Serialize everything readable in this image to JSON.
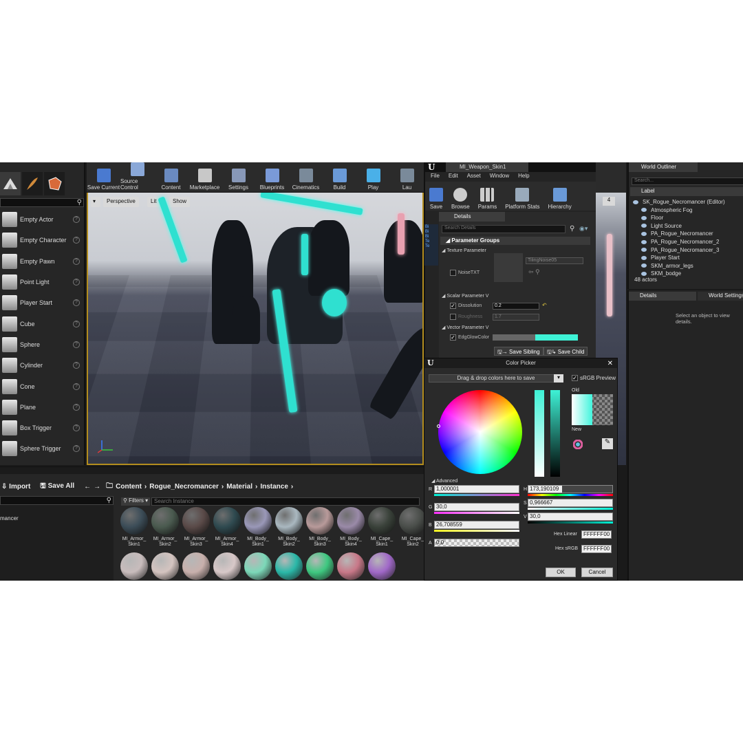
{
  "place_modes": {
    "items": [
      {
        "label": "Empty Actor",
        "icon": "empty-actor-icon"
      },
      {
        "label": "Empty Character",
        "icon": "character-icon"
      },
      {
        "label": "Empty Pawn",
        "icon": "pawn-icon"
      },
      {
        "label": "Point Light",
        "icon": "light-bulb-icon"
      },
      {
        "label": "Player Start",
        "icon": "player-start-icon"
      },
      {
        "label": "Cube",
        "icon": "cube-icon"
      },
      {
        "label": "Sphere",
        "icon": "sphere-icon"
      },
      {
        "label": "Cylinder",
        "icon": "cylinder-icon"
      },
      {
        "label": "Cone",
        "icon": "cone-icon"
      },
      {
        "label": "Plane",
        "icon": "plane-icon"
      },
      {
        "label": "Box Trigger",
        "icon": "box-trigger-icon"
      },
      {
        "label": "Sphere Trigger",
        "icon": "sphere-trigger-icon"
      }
    ]
  },
  "level_toolbar": {
    "buttons": [
      "Save Current",
      "Source Control",
      "Content",
      "Marketplace",
      "Settings",
      "Blueprints",
      "Cinematics",
      "Build",
      "Play",
      "Lau"
    ]
  },
  "viewport": {
    "perspective": "Perspective",
    "lit": "Lit",
    "show": "Show"
  },
  "content_browser": {
    "import": "Import",
    "save_all": "Save All",
    "breadcrumbs": [
      "Content",
      "Rogue_Necromancer",
      "Material",
      "Instance"
    ],
    "folder_fragment": "mancer",
    "filters": "Filters",
    "search_placeholder": "Search Instance",
    "assets_row1": [
      {
        "label": "MI_Armor_ Skin1",
        "color": "#3c4d58"
      },
      {
        "label": "MI_Armor_ Skin2",
        "color": "#4a5a4f"
      },
      {
        "label": "MI_Armor_ Skin3",
        "color": "#5a4a48"
      },
      {
        "label": "MI_Armor_ Skin4",
        "color": "#2f4a50"
      },
      {
        "label": "MI_Body_ Skin1",
        "color": "#9a98b8"
      },
      {
        "label": "MI_Body_ Skin2",
        "color": "#aab8c0"
      },
      {
        "label": "MI_Body_ Skin3",
        "color": "#b89a9a"
      },
      {
        "label": "MI_Body_ Skin4",
        "color": "#9a8aa8"
      },
      {
        "label": "MI_Cape_ Skin1",
        "color": "#3a423a"
      },
      {
        "label": "MI_Cape_ Skin2",
        "color": "#4a4e4a"
      }
    ],
    "assets_row2": [
      "#c8bcbc",
      "#d4c4c0",
      "#c8b0ac",
      "#d8c8c8",
      "#7cd8b8",
      "#2ab8a8",
      "#3ec880",
      "#c87888",
      "#a068c8"
    ]
  },
  "material_editor": {
    "tab": "MI_Weapon_Skin1",
    "menu": [
      "File",
      "Edit",
      "Asset",
      "Window",
      "Help"
    ],
    "toolbar": [
      "Save",
      "Browse",
      "Params",
      "Platform Stats",
      "Hierarchy"
    ],
    "details_tab": "Details",
    "search_placeholder": "Search Details",
    "parameter_groups": "Parameter Groups",
    "texture_section": "Texture Parameter",
    "noise_label": "NoiseTXT",
    "texture_name": "TilingNoise05",
    "scalar_section": "Scalar Parameter V",
    "dissolution_label": "Dissolution",
    "dissolution_value": "0.2",
    "roughness_label": "Roughness",
    "roughness_value": "1.7",
    "vector_section": "Vector Parameter V",
    "edge_glow_label": "EdgGlowColor",
    "save_sibling": "Save Sibling",
    "save_child": "Save Child",
    "side_number": "4"
  },
  "color_picker": {
    "title": "Color Picker",
    "drag_drop": "Drag & drop colors here to save",
    "srgb_preview": "sRGB Preview",
    "old_label": "Old",
    "new_label": "New",
    "advanced": "Advanced",
    "r_label": "R",
    "r_value": "1,000001",
    "g_label": "G",
    "g_value": "30,0",
    "b_label": "B",
    "b_value": "26,708559",
    "a_label": "A",
    "a_value": "0,0",
    "h_label": "H",
    "h_value": "173,190109",
    "s_label": "S",
    "s_value": "0,966667",
    "v_label": "V",
    "v_value": "30,0",
    "hex_linear_label": "Hex Linear",
    "hex_linear_value": "FFFFFF00",
    "hex_srgb_label": "Hex sRGB",
    "hex_srgb_value": "FFFFFF00",
    "ok": "OK",
    "cancel": "Cancel"
  },
  "world_outliner": {
    "title": "World Outliner",
    "search_placeholder": "Search...",
    "column": "Label",
    "actors": [
      "SK_Rogue_Necromancer (Editor)",
      "Atmospheric Fog",
      "Floor",
      "Light Source",
      "PA_Rogue_Necromancer",
      "PA_Rogue_Necromancer_2",
      "PA_Rogue_Necromancer_3",
      "Player Start",
      "SKM_armor_legs",
      "SKM_bodge"
    ],
    "count": "48 actors"
  },
  "details_panel": {
    "details_tab": "Details",
    "world_settings_tab": "World Settings",
    "empty_message": "Select an object to view details."
  }
}
